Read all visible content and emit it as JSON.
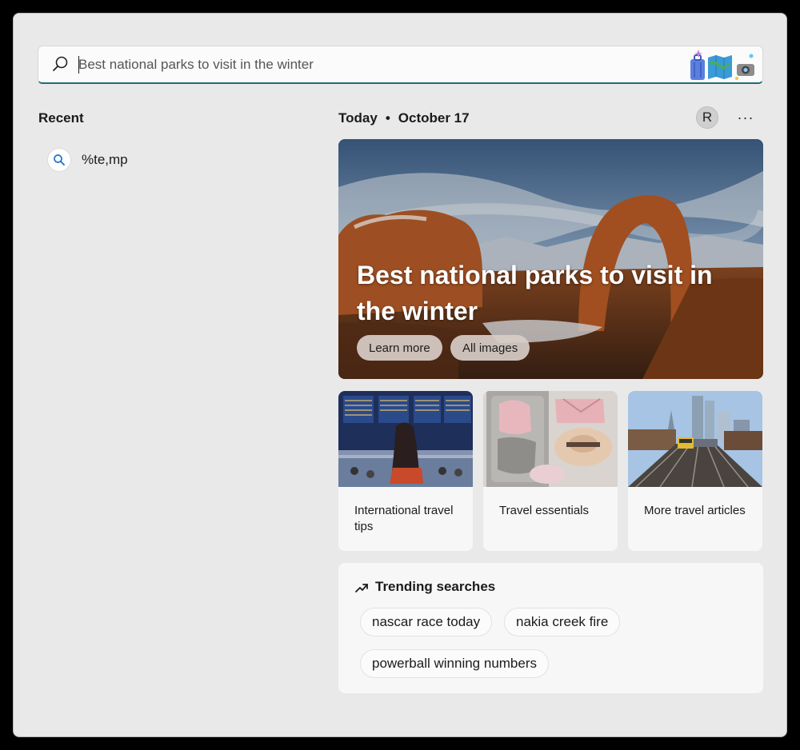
{
  "search": {
    "value": "",
    "placeholder": "Best national parks to visit in the winter"
  },
  "recent": {
    "title": "Recent",
    "items": [
      {
        "label": "%te,mp",
        "icon": "search-icon"
      }
    ]
  },
  "header": {
    "today_label": "Today",
    "separator": "•",
    "date": "October 17",
    "avatar_initial": "R",
    "more_label": "···"
  },
  "hero": {
    "title": "Best national parks to visit in the winter",
    "buttons": [
      "Learn more",
      "All images"
    ]
  },
  "cards": [
    {
      "label": "International travel tips"
    },
    {
      "label": "Travel essentials"
    },
    {
      "label": "More travel articles"
    }
  ],
  "trending": {
    "title": "Trending searches",
    "icon": "trending-up-icon",
    "items": [
      "nascar race today",
      "nakia creek fire",
      "powerball winning numbers"
    ]
  },
  "colors": {
    "accent": "#1f6b7b",
    "window_bg": "#e9e9e9",
    "card_bg": "#f7f7f7"
  }
}
